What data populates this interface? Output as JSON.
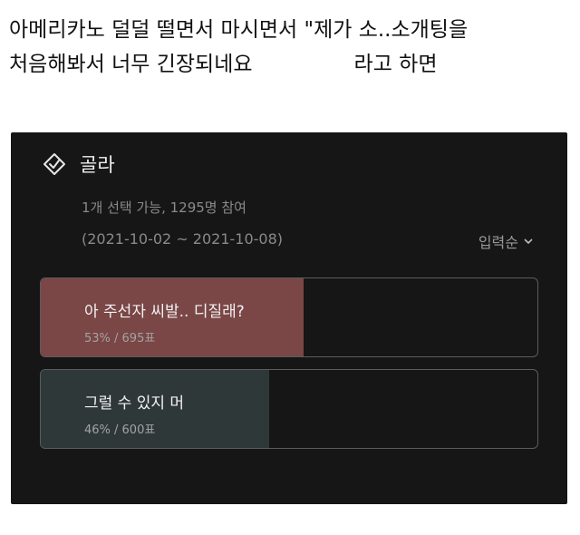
{
  "caption": {
    "line1": "아메리카노 덜덜 떨면서 마시면서 \"제가 소..소개팅을",
    "line2": "처음해봐서 너무 긴장되네요",
    "line2_tail": "라고 하면"
  },
  "poll": {
    "icon": "checkmark-diamond-icon",
    "title": "골라",
    "meta_count": "1개 선택 가능, 1295명 참여",
    "meta_dates": "(2021-10-02 ~ 2021-10-08)",
    "sort_label": "입력순",
    "options": [
      {
        "label": "아 주선자 씨발.. 디질래?",
        "stats": "53% / 695표",
        "percent": 53,
        "color": "#7a4646"
      },
      {
        "label": "그럴 수 있지 머",
        "stats": "46% / 600표",
        "percent": 46,
        "color": "#2f3839"
      }
    ]
  }
}
